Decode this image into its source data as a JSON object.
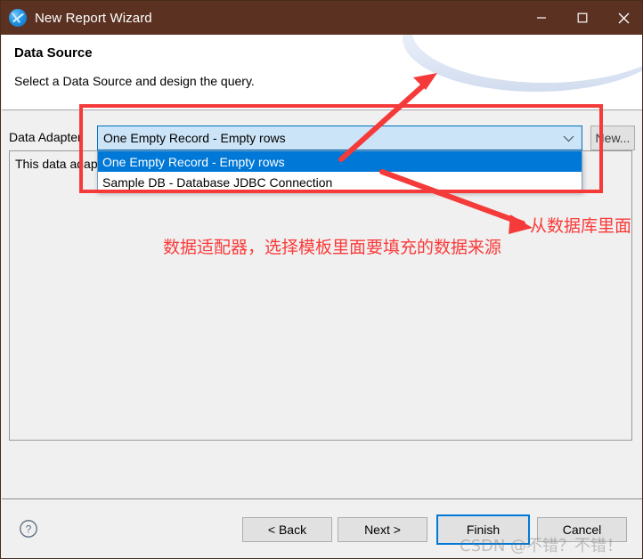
{
  "window": {
    "title": "New Report Wizard",
    "icon": "jasper-studio-icon",
    "titlebar_color": "#5b3222",
    "controls": [
      {
        "name": "minimize",
        "glyph": "minimize-icon"
      },
      {
        "name": "maximize",
        "glyph": "maximize-icon"
      },
      {
        "name": "close",
        "glyph": "close-icon"
      }
    ]
  },
  "header": {
    "title": "Data Source",
    "subtitle": "Select a Data Source and design the query."
  },
  "form": {
    "adapter_label": "Data Adapter",
    "combo": {
      "value": "One Empty Record - Empty rows",
      "arrow_icon": "chevron-down-icon",
      "background": "#cce4f7",
      "border": "#0071c1"
    },
    "new_button": "New...",
    "dropdown": {
      "options": [
        {
          "label": "One Empty Record - Empty rows",
          "selected": true
        },
        {
          "label": "Sample DB - Database JDBC Connection",
          "selected": false
        }
      ],
      "highlight_color": "#0078d7"
    },
    "description": "This data adap"
  },
  "footer": {
    "help_icon": "help-circle-icon",
    "buttons": {
      "back": "< Back",
      "next": "Next >",
      "finish": "Finish",
      "cancel": "Cancel"
    },
    "default_button_accent": "#0078d7"
  },
  "annotations": {
    "color": "#fb3a3a",
    "main_note": "数据适配器，选择模板里面要填充的数据来源",
    "side_note": "从数据库里面"
  },
  "watermark": "CSDN @不错？不错！"
}
